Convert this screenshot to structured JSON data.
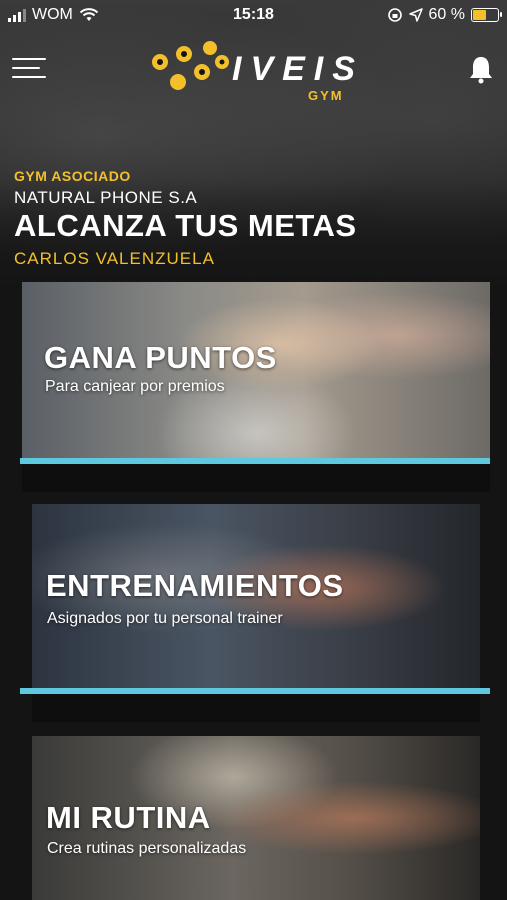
{
  "status_bar": {
    "carrier": "WOM",
    "time": "15:18",
    "battery": "60 %",
    "battery_level": 0.6
  },
  "brand": {
    "name": "IVEIS",
    "sub": "GYM",
    "accent_color": "#f3c02b"
  },
  "profile": {
    "gym_label": "GYM ASOCIADO",
    "company": "NATURAL PHONE S.A",
    "headline": "ALCANZA TUS METAS",
    "user_name": "CARLOS VALENZUELA"
  },
  "cards": [
    {
      "title": "GANA PUNTOS",
      "description": "Para canjear por premios"
    },
    {
      "title": "ENTRENAMIENTOS",
      "description": "Asignados por tu personal trainer"
    },
    {
      "title": "MI RUTINA",
      "description": "Crea rutinas personalizadas"
    }
  ],
  "icons": {
    "menu": "hamburger-icon",
    "notifications": "bell-icon",
    "wifi": "wifi-icon",
    "location": "location-arrow-icon",
    "rotation_lock": "rotation-lock-icon"
  },
  "colors": {
    "underline": "#5ec8de",
    "background": "#141414"
  }
}
